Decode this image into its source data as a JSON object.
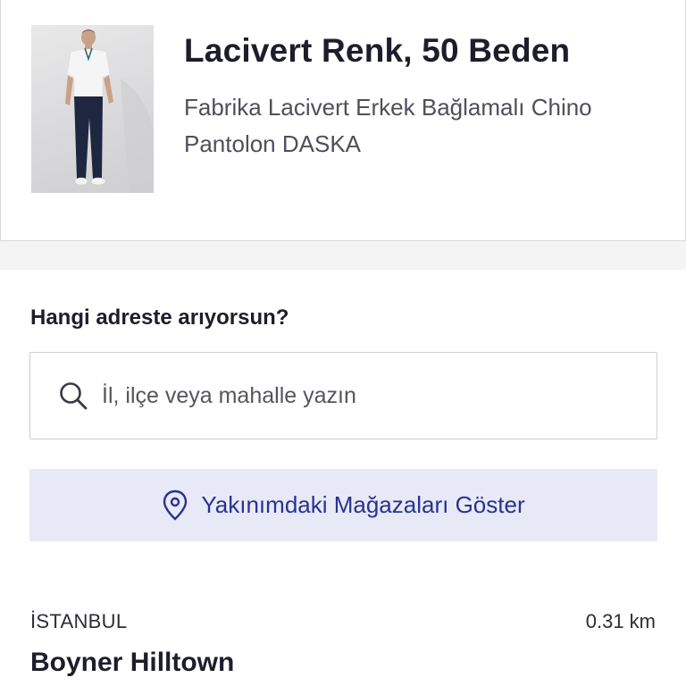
{
  "product": {
    "title": "Lacivert Renk, 50 Beden",
    "description": "Fabrika Lacivert Erkek Bağlamalı Chino Pantolon DASKA"
  },
  "address_search": {
    "question": "Hangi adreste arıyorsun?",
    "placeholder": "İl, ilçe veya mahalle yazın",
    "value": ""
  },
  "nearby_button": {
    "label": "Yakınımdaki Mağazaları Göster"
  },
  "stores": [
    {
      "city": "İSTANBUL",
      "distance": "0.31 km",
      "name": "Boyner Hilltown"
    }
  ],
  "colors": {
    "accent": "#2b3190",
    "button_bg": "#e8e9f6",
    "text": "#1d1d2b"
  }
}
